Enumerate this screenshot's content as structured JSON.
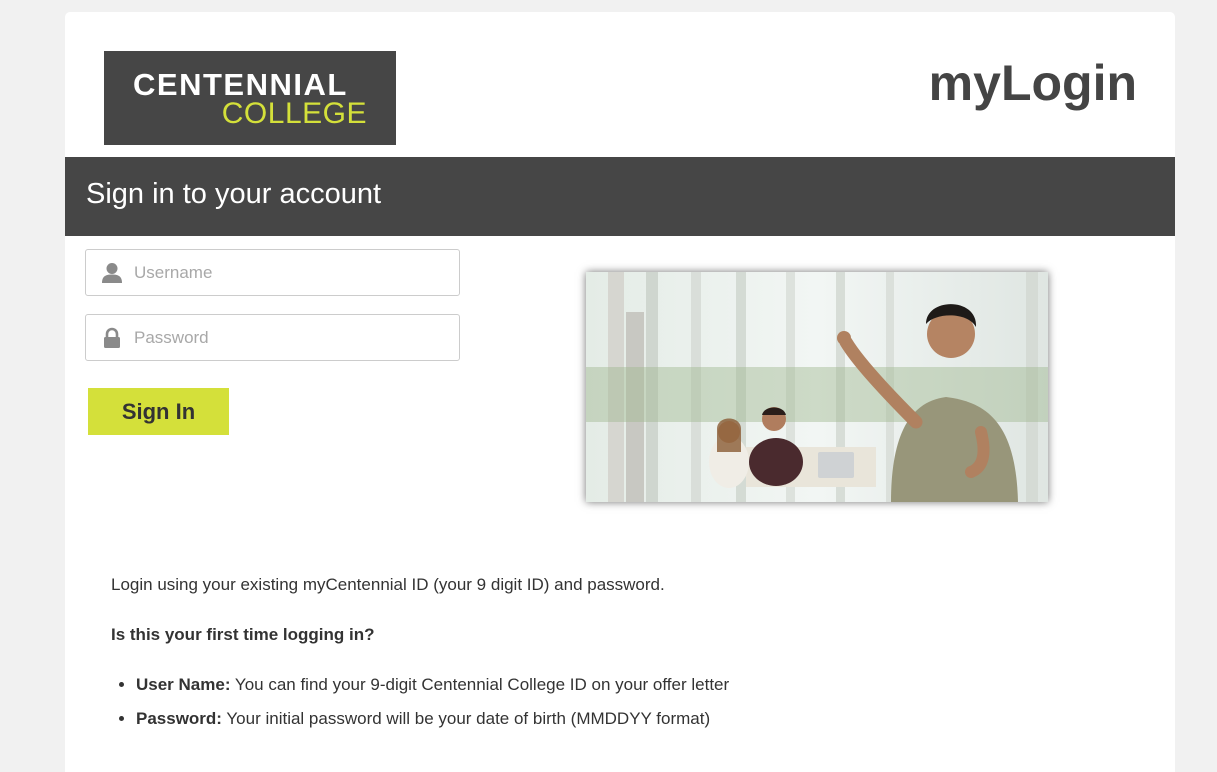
{
  "brand": {
    "logo_line1": "CENTENNIAL",
    "logo_line2": "COLLEGE",
    "app_title": "myLogin",
    "accent_color": "#d4e03a",
    "header_color": "#464646"
  },
  "banner": {
    "heading": "Sign in to your account"
  },
  "form": {
    "username": {
      "icon": "user-icon",
      "placeholder": "Username",
      "value": ""
    },
    "password": {
      "icon": "lock-icon",
      "placeholder": "Password",
      "value": ""
    },
    "submit_label": "Sign In"
  },
  "info": {
    "intro": "Login using your existing myCentennial ID (your 9 digit ID) and password.",
    "first_time_heading": "Is this your first time logging in?",
    "items": [
      {
        "label": "User Name:",
        "text": " You can find your 9-digit Centennial College ID on your offer letter"
      },
      {
        "label": "Password:",
        "text": " Your initial password will be your date of birth (MMDDYY format)"
      }
    ]
  }
}
